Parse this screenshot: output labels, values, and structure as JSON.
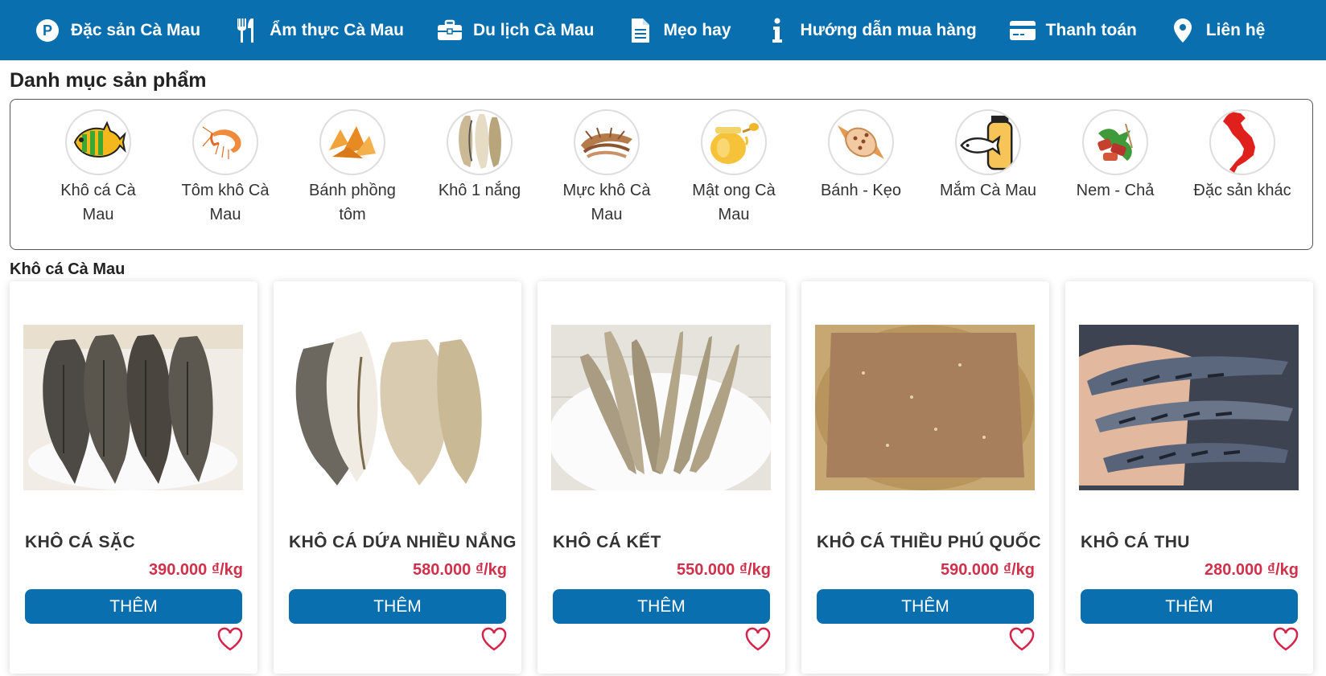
{
  "nav": {
    "items": [
      {
        "label": "Đặc sản Cà Mau",
        "icon": "parking-circle-icon"
      },
      {
        "label": "Ẩm thực Cà Mau",
        "icon": "utensils-icon"
      },
      {
        "label": "Du lịch Cà Mau",
        "icon": "briefcase-icon"
      },
      {
        "label": "Mẹo hay",
        "icon": "document-icon"
      },
      {
        "label": "Hướng dẫn mua hàng",
        "icon": "info-icon"
      },
      {
        "label": "Thanh toán",
        "icon": "credit-card-icon"
      },
      {
        "label": "Liên hệ",
        "icon": "map-pin-icon"
      }
    ]
  },
  "category": {
    "title": "Danh mục sản phẩm",
    "items": [
      {
        "label": "Khô cá Cà Mau",
        "icon": "fish-icon"
      },
      {
        "label": "Tôm khô Cà Mau",
        "icon": "shrimp-icon"
      },
      {
        "label": "Bánh phồng tôm",
        "icon": "shrimp-cracker-icon"
      },
      {
        "label": "Khô 1 nắng",
        "icon": "dried-fish-icon"
      },
      {
        "label": "Mực khô Cà Mau",
        "icon": "dried-squid-icon"
      },
      {
        "label": "Mật ong Cà Mau",
        "icon": "honey-jar-icon"
      },
      {
        "label": "Bánh - Kẹo",
        "icon": "candy-icon"
      },
      {
        "label": "Mắm Cà Mau",
        "icon": "fish-sauce-jar-icon"
      },
      {
        "label": "Nem - Chả",
        "icon": "sausage-icon"
      },
      {
        "label": "Đặc sản khác",
        "icon": "vietnam-map-icon"
      }
    ]
  },
  "section": {
    "title": "Khô cá Cà Mau",
    "products": [
      {
        "name": "KHÔ CÁ SẶC",
        "price": "390.000 ₫/kg",
        "button": "THÊM"
      },
      {
        "name": "KHÔ CÁ DỨA NHIỀU NẮNG",
        "price": "580.000 ₫/kg",
        "button": "THÊM"
      },
      {
        "name": "KHÔ CÁ KẾT",
        "price": "550.000 ₫/kg",
        "button": "THÊM"
      },
      {
        "name": "KHÔ CÁ THIỀU PHÚ QUỐC",
        "price": "590.000 ₫/kg",
        "button": "THÊM"
      },
      {
        "name": "KHÔ CÁ THU",
        "price": "280.000 ₫/kg",
        "button": "THÊM"
      }
    ]
  },
  "colors": {
    "brand": "#0a6fae",
    "price": "#d0304a",
    "heart": "#d6234a"
  }
}
